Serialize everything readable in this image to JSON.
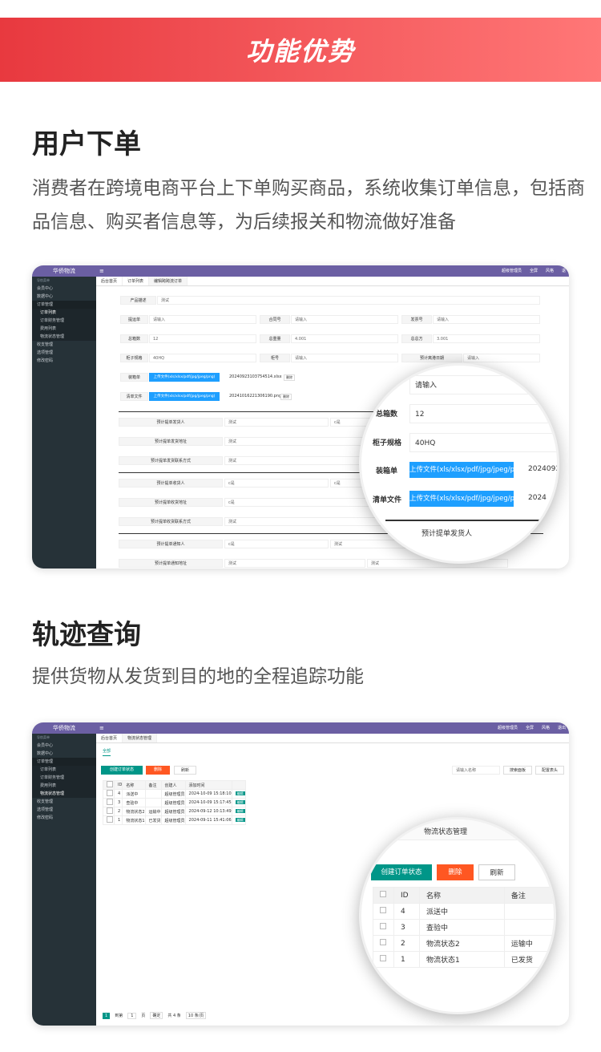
{
  "banner": {
    "title": "功能优势"
  },
  "section1": {
    "title": "用户下单",
    "desc": "消费者在跨境电商平台上下单购买商品，系统收集订单信息，包括商品信息、购买者信息等，为后续报关和物流做好准备"
  },
  "section2": {
    "title": "轨迹查询",
    "desc": "提供货物从发货到目的地的全程追踪功能"
  },
  "app": {
    "brand": "华侨物流",
    "menu_icon": "≡",
    "user": "超级管理员",
    "fullscreen": "全屏",
    "style": "风格",
    "logout": "退出",
    "logout_short": "退",
    "side_header": "导航菜单",
    "side": [
      {
        "label": "会员中心",
        "icon": "users-icon"
      },
      {
        "label": "数据中心",
        "icon": "cog-icon"
      },
      {
        "label": "订单管理",
        "icon": "list-icon"
      }
    ],
    "side_sub": [
      "订单列表",
      "订单财务管理",
      "费用列表",
      "物流状态管理"
    ],
    "side_after": [
      {
        "label": "收支管理"
      },
      {
        "label": "选项管理"
      },
      {
        "label": "修改密码"
      }
    ]
  },
  "screen1": {
    "tabs": [
      "后台首页",
      "订单列表",
      "编辑跨跨流订单"
    ],
    "fields": {
      "product_desc_label": "产品描述",
      "product_desc_value": "测试",
      "tracking_label": "提运单",
      "tracking_ph": "请输入",
      "contract_label": "合同号",
      "contract_ph": "请输入",
      "invoice_label": "发票号",
      "invoice_ph": "请输入",
      "boxes_label": "总箱数",
      "boxes_value": "12",
      "weight_label": "总重量",
      "weight_value": "4.001",
      "volume_label": "总总方",
      "volume_value": "3.001",
      "container_label": "柜子规格",
      "container_value": "40HQ",
      "cabinet_label": "柜号",
      "cabinet_ph": "请输入",
      "est_label": "预计离港日期",
      "est_ph": "请输入",
      "packing_label": "装箱单",
      "upload_label": "上传文件(xls/xlsx/pdf/jpg/jpeg/png)",
      "packing_file": "20240923103754514.xlsx",
      "list_label": "清单文件",
      "list_file": "20241016221306190.png",
      "del": "删除",
      "row1_label": "预计提单发货人",
      "row1_a": "测试",
      "row1_b": "c是",
      "row2_label": "预计提单发货地址",
      "row2_a": "测试",
      "row3_label": "预计提单发货联系方式",
      "row3_a": "测试",
      "row4_label": "预计提单收货人",
      "row4_a": "c是",
      "row4_b": "c是",
      "row5_label": "预计提单收货地址",
      "row5_a": "c是",
      "row6_label": "预计提单收货联系方式",
      "row6_a": "测试",
      "row7_label": "预计提单通知人",
      "row7_a": "c是",
      "row7_b": "测试",
      "row8_label": "预计提单通知地址",
      "row8_a": "测试",
      "row8_b": "测试"
    },
    "magnifier": {
      "ph": "请输入",
      "boxes_label": "总箱数",
      "boxes_value": "12",
      "container_label": "柜子规格",
      "container_value": "40HQ",
      "packing_label": "装箱单",
      "upload_label": "上传文件(xls/xlsx/pdf/jpg/jpeg/png)",
      "packing_file": "2024092",
      "list_label": "清单文件",
      "list_file": "2024",
      "shipper_label": "预计提单发货人"
    }
  },
  "screen2": {
    "tabs": [
      "后台首页",
      "物流状态管理"
    ],
    "subtab": "全部",
    "create": "创建订单状态",
    "delete": "删除",
    "refresh": "刷新",
    "search_ph": "请输入名称",
    "search_btn": "搜索面板",
    "config_btn": "配置表头",
    "columns": [
      "ID",
      "名称",
      "备注",
      "创建人",
      "添加时间"
    ],
    "rows": [
      {
        "id": "4",
        "name": "派送中",
        "note": "",
        "creator": "超级管理员",
        "time": "2024-10-09 15:18:10",
        "op": "编辑"
      },
      {
        "id": "3",
        "name": "查验中",
        "note": "",
        "creator": "超级管理员",
        "time": "2024-10-09 15:17:45",
        "op": "编辑"
      },
      {
        "id": "2",
        "name": "物流状态2",
        "note": "运输中",
        "creator": "超级管理员",
        "time": "2024-09-12 10:13:49",
        "op": "编辑"
      },
      {
        "id": "1",
        "name": "物流状态1",
        "note": "已发货",
        "creator": "超级管理员",
        "time": "2024-09-11 15:41:06",
        "op": "编辑"
      }
    ],
    "pager": {
      "current": "1",
      "goto": "到第",
      "page": "1",
      "unit": "页",
      "ok": "确定",
      "total": "共 4 条",
      "size": "10 条/页"
    },
    "magnifier": {
      "tab": "物流状态管理",
      "create": "创建订单状态",
      "delete": "删除",
      "refresh": "刷新"
    }
  }
}
